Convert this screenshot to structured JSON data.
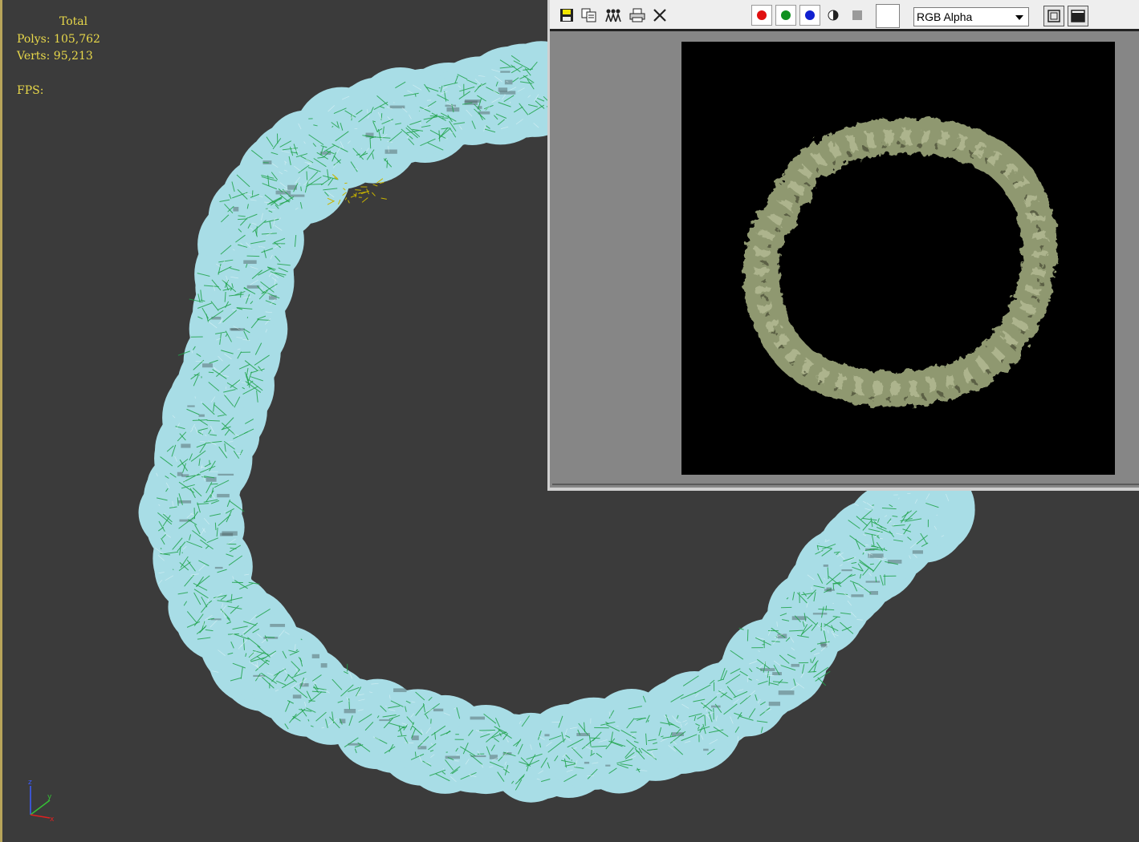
{
  "viewport": {
    "stats": {
      "total_label": "Total",
      "polys_label": "Polys:",
      "polys_value": "105,762",
      "verts_label": "Verts:",
      "verts_value": "95,213",
      "fps_label": "FPS:"
    },
    "axis": {
      "x": "x",
      "y": "y",
      "z": "z"
    },
    "colors": {
      "background": "#3b3b3b",
      "stats_text": "#e8d84a",
      "mesh_fill": "#a8dde6",
      "mesh_wire": "#1fa34a",
      "selected_wire": "#c8b400"
    }
  },
  "render_window": {
    "toolbar": {
      "icons": [
        "save-icon",
        "clone-icon",
        "channel-all-icon",
        "print-icon",
        "close-icon"
      ],
      "channels": [
        {
          "name": "red-channel",
          "color": "#e01010"
        },
        {
          "name": "green-channel",
          "color": "#109020"
        },
        {
          "name": "blue-channel",
          "color": "#1020d0"
        }
      ],
      "display_channel": "RGB Alpha"
    },
    "canvas_background": "#000000",
    "ring_color": "#8f9870"
  }
}
